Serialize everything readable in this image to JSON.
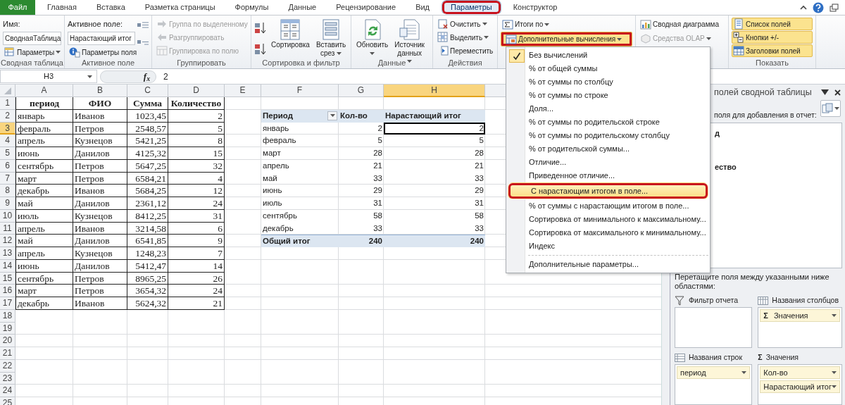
{
  "tabs": [
    {
      "label": "Файл",
      "kind": "file",
      "selected": false,
      "circled": false
    },
    {
      "label": "Главная",
      "kind": "tab",
      "selected": false,
      "circled": false
    },
    {
      "label": "Вставка",
      "kind": "tab",
      "selected": false,
      "circled": false
    },
    {
      "label": "Разметка страницы",
      "kind": "tab",
      "selected": false,
      "circled": false
    },
    {
      "label": "Формулы",
      "kind": "tab",
      "selected": false,
      "circled": false
    },
    {
      "label": "Данные",
      "kind": "tab",
      "selected": false,
      "circled": false
    },
    {
      "label": "Рецензирование",
      "kind": "tab",
      "selected": false,
      "circled": false
    },
    {
      "label": "Вид",
      "kind": "tab",
      "selected": false,
      "circled": false
    },
    {
      "label": "Параметры",
      "kind": "tab",
      "selected": true,
      "circled": true
    },
    {
      "label": "Конструктор",
      "kind": "tab",
      "selected": false,
      "circled": false
    }
  ],
  "ribbon": [
    {
      "label": "Сводная таблица",
      "items": [
        {
          "kind": "text",
          "label": "Имя:"
        },
        {
          "kind": "field",
          "value": "СводнаяТаблица"
        },
        {
          "kind": "small",
          "label": "Параметры",
          "caret": true,
          "disabled": false,
          "on": false,
          "circled": false
        }
      ]
    },
    {
      "label": "Активное поле",
      "items": [
        {
          "kind": "text",
          "label": "Активное поле:"
        },
        {
          "kind": "field",
          "value": "Нарастающий итог"
        },
        {
          "kind": "small",
          "label": "Параметры поля",
          "caret": false,
          "disabled": false,
          "on": false,
          "circled": false
        },
        {
          "kind": "field_buttons"
        }
      ]
    },
    {
      "label": "Группировать",
      "items": [
        {
          "kind": "small",
          "label": "Группа по выделенному",
          "caret": false,
          "disabled": true,
          "on": false,
          "circled": false
        },
        {
          "kind": "small",
          "label": "Разгруппировать",
          "caret": false,
          "disabled": true,
          "on": false,
          "circled": false
        },
        {
          "kind": "small",
          "label": "Группировка по полю",
          "caret": false,
          "disabled": true,
          "on": false,
          "circled": false
        }
      ]
    },
    {
      "label": "Сортировка и фильтр",
      "items": [
        {
          "kind": "sort_buttons"
        },
        {
          "kind": "large",
          "label": "Сортировка",
          "caret": false,
          "disabled": false,
          "on": false,
          "circled": false
        },
        {
          "kind": "large",
          "label": "Вставить срез",
          "caret": true,
          "disabled": false,
          "on": false,
          "circled": false
        }
      ]
    },
    {
      "label": "Данные",
      "items": [
        {
          "kind": "large",
          "label": "Обновить",
          "caret": true,
          "disabled": false,
          "on": false,
          "circled": false
        },
        {
          "kind": "large",
          "label": "Источник данных",
          "caret": true,
          "disabled": false,
          "on": false,
          "circled": false
        }
      ]
    },
    {
      "label": "Действия",
      "items": [
        {
          "kind": "small",
          "label": "Очистить",
          "caret": true,
          "disabled": false,
          "on": false,
          "circled": false
        },
        {
          "kind": "small",
          "label": "Выделить",
          "caret": true,
          "disabled": false,
          "on": false,
          "circled": false
        },
        {
          "kind": "small",
          "label": "Переместить",
          "caret": false,
          "disabled": false,
          "on": false,
          "circled": false
        }
      ]
    },
    {
      "items": [
        {
          "kind": "small",
          "label": "Итоги по",
          "caret": true,
          "disabled": false,
          "on": false,
          "circled": false
        },
        {
          "kind": "small",
          "label": "Дополнительные вычисления",
          "caret": true,
          "disabled": false,
          "on": true,
          "circled": true
        }
      ]
    },
    {
      "items": [
        {
          "kind": "small",
          "label": "Сводная диаграмма",
          "caret": false,
          "disabled": false,
          "on": false,
          "circled": false
        },
        {
          "kind": "small",
          "label": "Средства OLAP",
          "caret": true,
          "disabled": true,
          "on": false,
          "circled": false
        }
      ]
    },
    {
      "label": "Показать",
      "items": [
        {
          "kind": "small",
          "label": "Список полей",
          "caret": false,
          "disabled": false,
          "on": true,
          "circled": false
        },
        {
          "kind": "small",
          "label": "Кнопки +/-",
          "caret": false,
          "disabled": false,
          "on": true,
          "circled": false
        },
        {
          "kind": "small",
          "label": "Заголовки полей",
          "caret": false,
          "disabled": false,
          "on": true,
          "circled": false
        }
      ]
    }
  ],
  "formula_bar": {
    "name_box": "H3",
    "function_label": "f$_{x}$",
    "formula": "2"
  },
  "columns": [
    {
      "letter": "A",
      "selected": false
    },
    {
      "letter": "B",
      "selected": false
    },
    {
      "letter": "C",
      "selected": false
    },
    {
      "letter": "D",
      "selected": false
    },
    {
      "letter": "E",
      "selected": false
    },
    {
      "letter": "F",
      "selected": false
    },
    {
      "letter": "G",
      "selected": false
    },
    {
      "letter": "H",
      "selected": true
    }
  ],
  "row_headers": [
    {
      "number": "1",
      "selected": false
    },
    {
      "number": "2",
      "selected": false
    },
    {
      "number": "3",
      "selected": true
    },
    {
      "number": "4",
      "selected": false
    },
    {
      "number": "5",
      "selected": false
    },
    {
      "number": "6",
      "selected": false
    },
    {
      "number": "7",
      "selected": false
    },
    {
      "number": "8",
      "selected": false
    },
    {
      "number": "9",
      "selected": false
    },
    {
      "number": "10",
      "selected": false
    },
    {
      "number": "11",
      "selected": false
    },
    {
      "number": "12",
      "selected": false
    },
    {
      "number": "13",
      "selected": false
    },
    {
      "number": "14",
      "selected": false
    },
    {
      "number": "15",
      "selected": false
    },
    {
      "number": "16",
      "selected": false
    },
    {
      "number": "17",
      "selected": false
    },
    {
      "number": "18",
      "selected": false
    },
    {
      "number": "19",
      "selected": false
    },
    {
      "number": "20",
      "selected": false
    },
    {
      "number": "21",
      "selected": false
    },
    {
      "number": "22",
      "selected": false
    },
    {
      "number": "23",
      "selected": false
    },
    {
      "number": "24",
      "selected": false
    },
    {
      "number": "25",
      "selected": false
    }
  ],
  "source_table": {
    "header": [
      "период",
      "ФИО",
      "Сумма",
      "Количество"
    ],
    "rows": [
      [
        "январь",
        "Иванов",
        "1023,45",
        "2"
      ],
      [
        "февраль",
        "Петров",
        "2548,57",
        "5"
      ],
      [
        "апрель",
        "Кузнецов",
        "5421,25",
        "8"
      ],
      [
        "июнь",
        "Данилов",
        "4125,32",
        "15"
      ],
      [
        "сентябрь",
        "Петров",
        "5647,25",
        "32"
      ],
      [
        "март",
        "Петров",
        "6584,21",
        "4"
      ],
      [
        "декабрь",
        "Иванов",
        "5684,25",
        "12"
      ],
      [
        "май",
        "Данилов",
        "2361,12",
        "24"
      ],
      [
        "июль",
        "Кузнецов",
        "8412,25",
        "31"
      ],
      [
        "апрель",
        "Иванов",
        "3214,58",
        "6"
      ],
      [
        "май",
        "Данилов",
        "6541,85",
        "9"
      ],
      [
        "апрель",
        "Кузнецов",
        "1248,23",
        "7"
      ],
      [
        "июнь",
        "Данилов",
        "5412,47",
        "14"
      ],
      [
        "сентябрь",
        "Петров",
        "8965,25",
        "26"
      ],
      [
        "март",
        "Петров",
        "3654,32",
        "24"
      ],
      [
        "декабрь",
        "Иванов",
        "5624,32",
        "21"
      ]
    ]
  },
  "pivot_table": {
    "header": [
      "Период",
      "Кол-во",
      "Нарастающий итог"
    ],
    "rows": [
      {
        "period": "январь",
        "count": "2",
        "running_total": "2",
        "selected": true
      },
      {
        "period": "февраль",
        "count": "5",
        "running_total": "5",
        "selected": false
      },
      {
        "period": "март",
        "count": "28",
        "running_total": "28",
        "selected": false
      },
      {
        "period": "апрель",
        "count": "21",
        "running_total": "21",
        "selected": false
      },
      {
        "period": "май",
        "count": "33",
        "running_total": "33",
        "selected": false
      },
      {
        "period": "июнь",
        "count": "29",
        "running_total": "29",
        "selected": false
      },
      {
        "period": "июль",
        "count": "31",
        "running_total": "31",
        "selected": false
      },
      {
        "period": "сентябрь",
        "count": "58",
        "running_total": "58",
        "selected": false
      },
      {
        "period": "декабрь",
        "count": "33",
        "running_total": "33",
        "selected": false
      }
    ],
    "total": {
      "label": "Общий итог",
      "count": "240",
      "running_total": "240"
    }
  },
  "menu": {
    "items": [
      {
        "label": "Без вычислений",
        "checked": true,
        "hovered": false,
        "circled": false,
        "divider_before": false
      },
      {
        "label": "% от общей суммы",
        "checked": false,
        "hovered": false,
        "circled": false,
        "divider_before": false
      },
      {
        "label": "% от суммы по столбцу",
        "checked": false,
        "hovered": false,
        "circled": false,
        "divider_before": false
      },
      {
        "label": "% от суммы по строке",
        "checked": false,
        "hovered": false,
        "circled": false,
        "divider_before": false
      },
      {
        "label": "Доля...",
        "checked": false,
        "hovered": false,
        "circled": false,
        "divider_before": false
      },
      {
        "label": "% от суммы по родительской строке",
        "checked": false,
        "hovered": false,
        "circled": false,
        "divider_before": false
      },
      {
        "label": "% от суммы по родительскому столбцу",
        "checked": false,
        "hovered": false,
        "circled": false,
        "divider_before": false
      },
      {
        "label": "% от родительской суммы...",
        "checked": false,
        "hovered": false,
        "circled": false,
        "divider_before": false
      },
      {
        "label": "Отличие...",
        "checked": false,
        "hovered": false,
        "circled": false,
        "divider_before": false
      },
      {
        "label": "Приведенное отличие...",
        "checked": false,
        "hovered": false,
        "circled": false,
        "divider_before": false
      },
      {
        "label": "С нарастающим итогом в поле...",
        "checked": false,
        "hovered": true,
        "circled": true,
        "divider_before": false
      },
      {
        "label": "% от суммы с нарастающим итогом в поле...",
        "checked": false,
        "hovered": false,
        "circled": false,
        "divider_before": false
      },
      {
        "label": "Сортировка от минимального к максимальному...",
        "checked": false,
        "hovered": false,
        "circled": false,
        "divider_before": false
      },
      {
        "label": "Сортировка от максимального к минимальному...",
        "checked": false,
        "hovered": false,
        "circled": false,
        "divider_before": false
      },
      {
        "label": "Индекс",
        "checked": false,
        "hovered": false,
        "circled": false,
        "divider_before": false
      },
      {
        "label": "Дополнительные параметры...",
        "checked": false,
        "hovered": false,
        "circled": false,
        "divider_before": true
      }
    ]
  },
  "field_list": {
    "title": "полей сводной таблицы",
    "choose_label": "поля для добавления в отчет:",
    "fields": [
      {
        "label": "д",
        "in_use": true
      },
      {
        "label": "ество",
        "in_use": true
      }
    ],
    "drag_hint": "Перетащите поля между указанными ниже областями:",
    "areas": [
      {
        "title": "Фильтр отчета",
        "kind": "filter"
      },
      {
        "title": "Названия столбцов",
        "kind": "columns",
        "items": [
          {
            "label": "Значения",
            "symbol": "Σ"
          }
        ]
      },
      {
        "title": "Названия строк",
        "kind": "rows",
        "items": [
          {
            "label": "период"
          }
        ]
      },
      {
        "title": "Значения",
        "kind": "values",
        "symbol": "Σ",
        "items": [
          {
            "label": "Кол-во"
          },
          {
            "label": "Нарастающий итог"
          }
        ]
      }
    ]
  }
}
